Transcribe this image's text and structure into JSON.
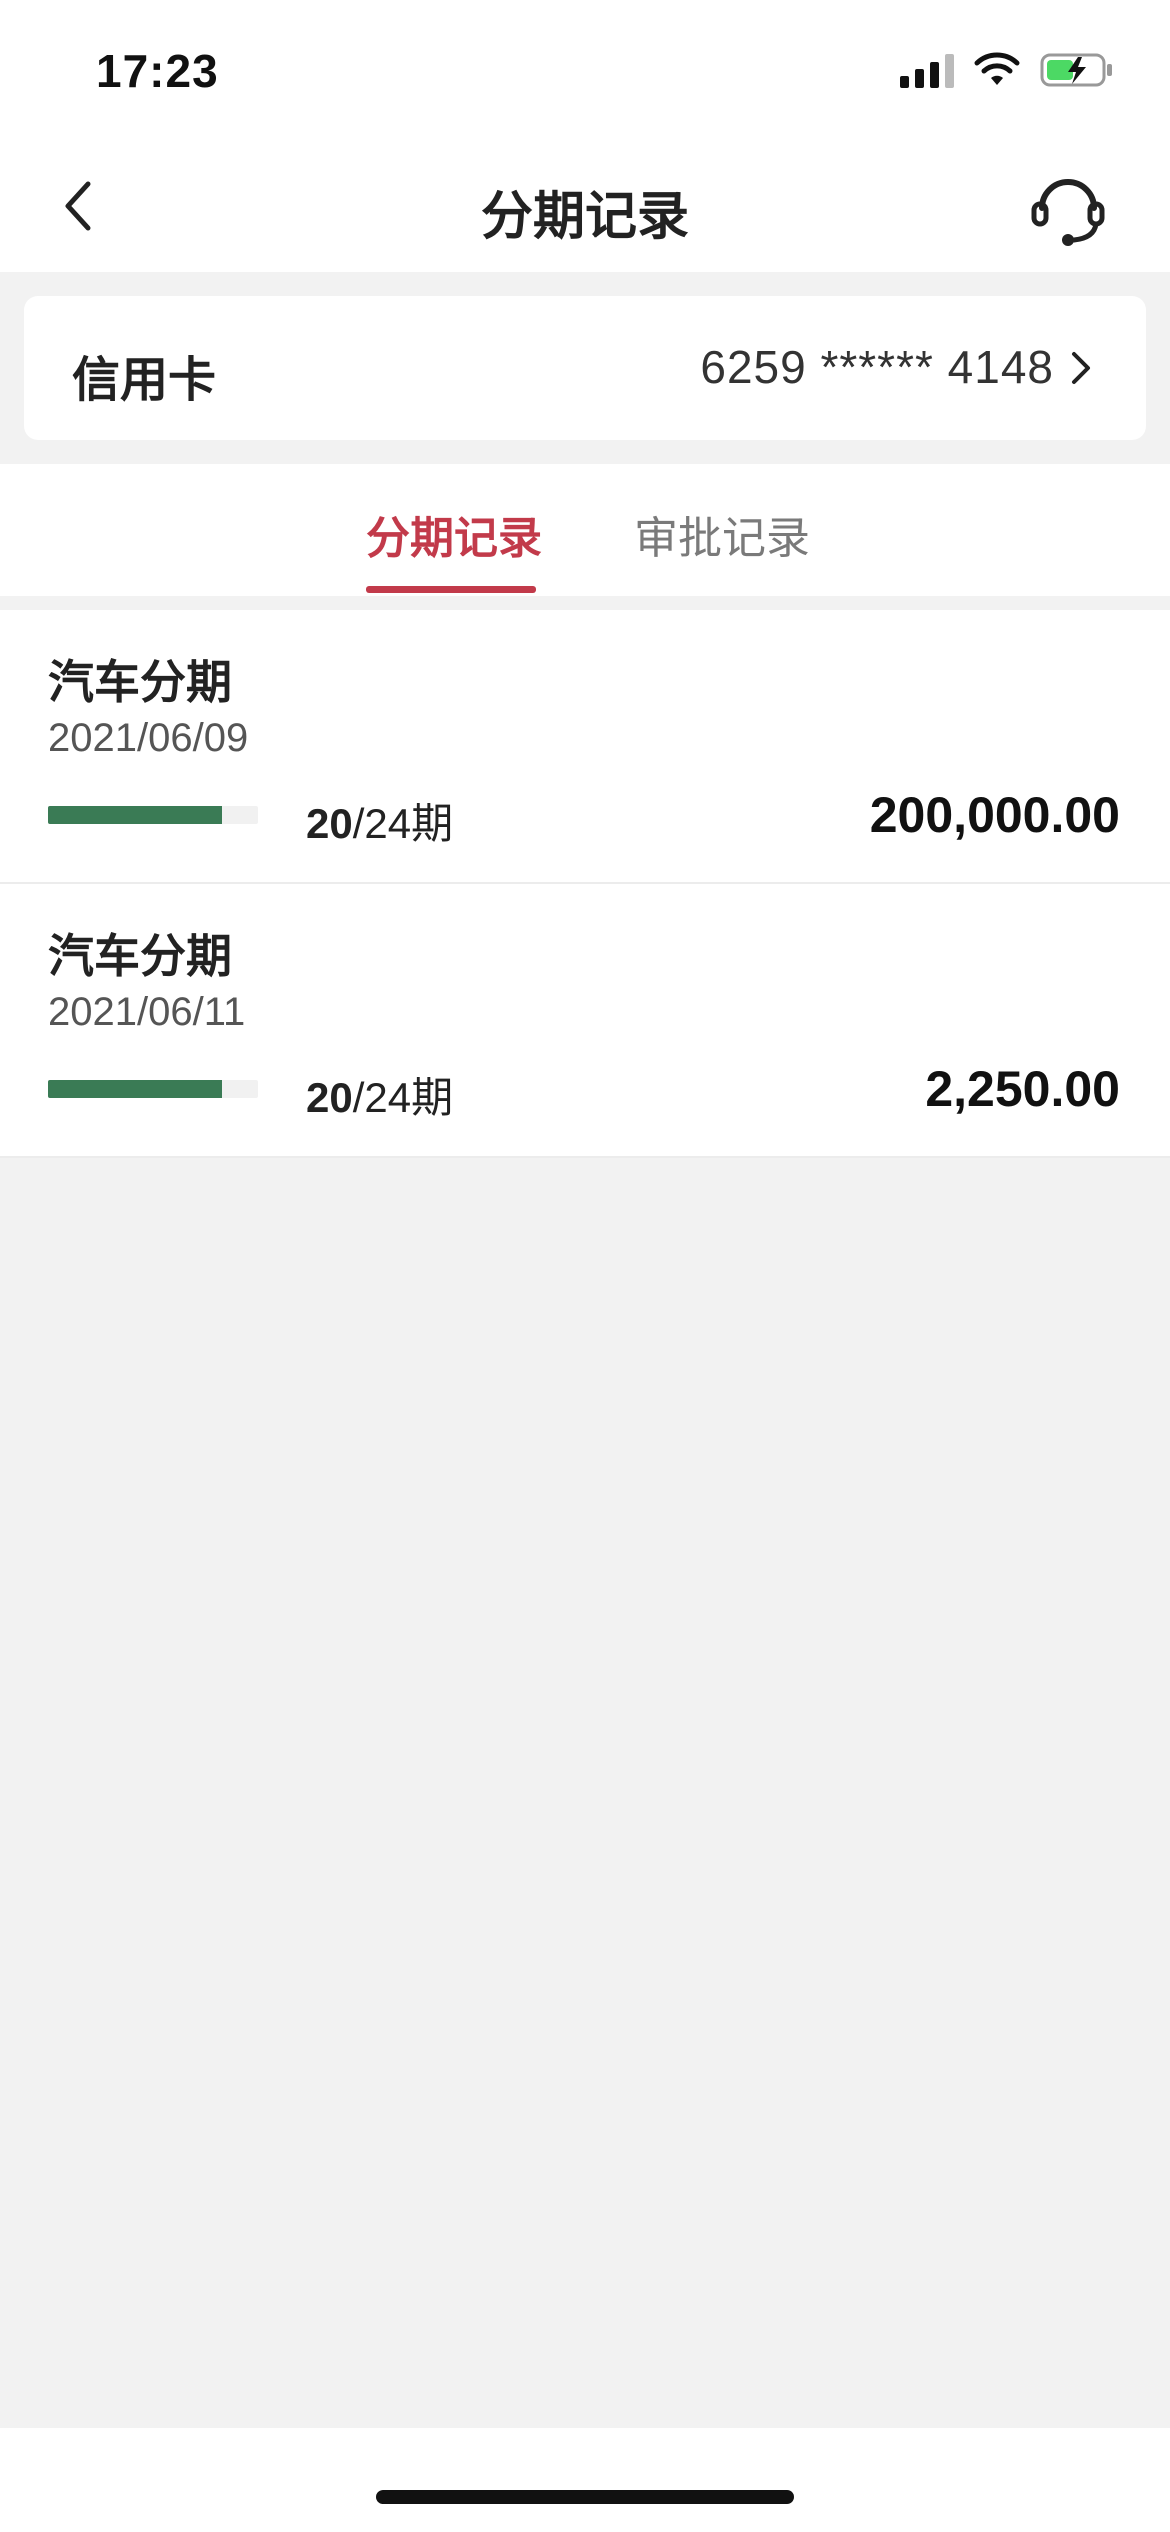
{
  "status_bar": {
    "time": "17:23",
    "signal_icon": "cellular-signal-icon",
    "wifi_icon": "wifi-icon",
    "battery_icon": "battery-charging-icon"
  },
  "nav": {
    "back_icon": "chevron-left-icon",
    "title": "分期记录",
    "service_icon": "headset-icon"
  },
  "card": {
    "label": "信用卡",
    "number": "6259 ****** 4148",
    "chevron_icon": "chevron-right-icon"
  },
  "tabs": [
    {
      "label": "分期记录",
      "active": true
    },
    {
      "label": "审批记录",
      "active": false
    }
  ],
  "records": [
    {
      "title": "汽车分期",
      "date": "2021/06/09",
      "progress": 0.83,
      "term_current": "20",
      "term_rest": "/24期",
      "amount": "200,000.00"
    },
    {
      "title": "汽车分期",
      "date": "2021/06/11",
      "progress": 0.83,
      "term_current": "20",
      "term_rest": "/24期",
      "amount": "2,250.00"
    }
  ],
  "colors": {
    "accent": "#c23a4a",
    "progress": "#3a7b55",
    "battery": "#4cd964"
  }
}
